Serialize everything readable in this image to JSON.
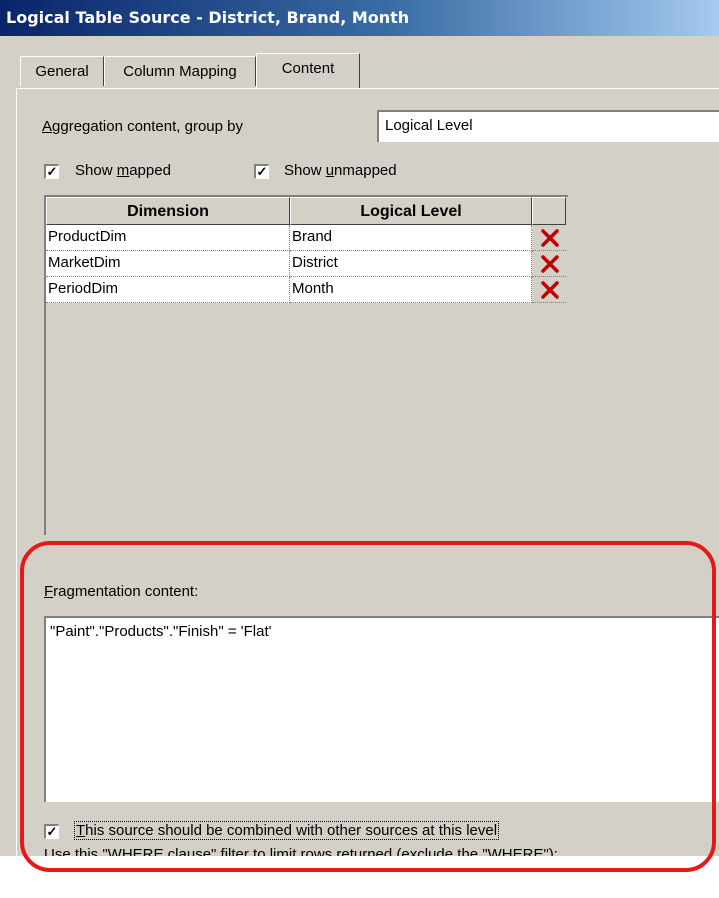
{
  "window": {
    "title": "Logical Table Source - District, Brand, Month"
  },
  "tabs": [
    {
      "label": "General"
    },
    {
      "label": "Column Mapping"
    },
    {
      "label": "Content"
    }
  ],
  "aggregation": {
    "label_pre": "A",
    "label_rest": "ggregation content, group by",
    "value": "Logical Level"
  },
  "checkboxes": {
    "show_mapped": {
      "pre": "Show ",
      "u": "m",
      "post": "apped",
      "checked": true
    },
    "show_unmapped": {
      "pre": "Show ",
      "u": "u",
      "post": "nmapped",
      "checked": true
    }
  },
  "grid": {
    "columns": [
      "Dimension",
      "Logical Level"
    ],
    "rows": [
      {
        "dimension": "ProductDim",
        "level": "Brand"
      },
      {
        "dimension": "MarketDim",
        "level": "District"
      },
      {
        "dimension": "PeriodDim",
        "level": "Month"
      }
    ],
    "delete_icon": "delete-x-icon"
  },
  "fragmentation": {
    "label_pre": "F",
    "label_rest": "ragmentation content:",
    "value": "\"Paint\".\"Products\".\"Finish\" = 'Flat'"
  },
  "combine": {
    "label_pre": "T",
    "label_rest": "his source should be combined with other sources at this level",
    "checked": true
  },
  "where_hint": "Use this \"WHERE clause\" filter to limit rows returned (exclude the \"WHERE\"):",
  "colors": {
    "highlight_ring": "#e41a1a",
    "delete_icon": "#c00000"
  }
}
